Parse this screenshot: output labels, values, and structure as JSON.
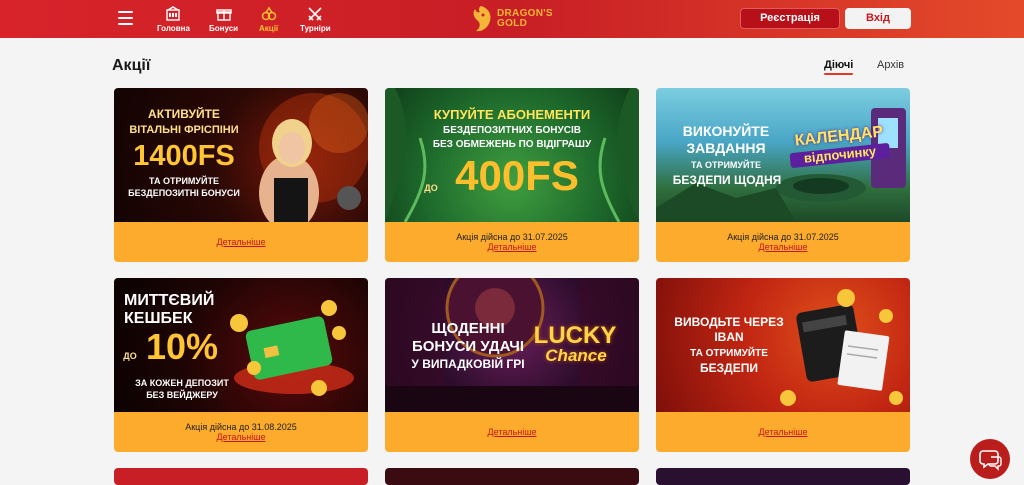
{
  "header": {
    "nav": [
      {
        "label": "Головна",
        "icon": "casino-icon"
      },
      {
        "label": "Бонуси",
        "icon": "gift-icon"
      },
      {
        "label": "Акції",
        "icon": "promo-icon"
      },
      {
        "label": "Турніри",
        "icon": "swords-icon"
      }
    ],
    "logo_line1": "DRAGON'S",
    "logo_line2": "GOLD",
    "register_label": "Реєстрація",
    "login_label": "Вхід",
    "colors": {
      "brand_red": "#d8232a",
      "accent_gold": "#fcab2c"
    }
  },
  "page": {
    "title": "Акції",
    "tabs": [
      {
        "label": "Діючі"
      },
      {
        "label": "Архів"
      }
    ]
  },
  "cards": [
    {
      "banner": [
        "АКТИВУЙТЕ",
        "ВІТАЛЬНІ ФРІСПІНИ",
        "1400FS",
        "ТА ОТРИМУЙТЕ",
        "БЕЗДЕПОЗИТНІ БОНУСИ"
      ],
      "valid": "",
      "more": "Детальніше"
    },
    {
      "banner": [
        "КУПУЙТЕ АБОНЕМЕНТИ",
        "БЕЗДЕПОЗИТНИХ БОНУСІВ",
        "БЕЗ ОБМЕЖЕНЬ ПО ВІДІГРАШУ",
        "ДО",
        "400FS"
      ],
      "valid": "Акція дійсна до 31.07.2025",
      "more": "Детальніше"
    },
    {
      "banner": [
        "ВИКОНУЙТЕ",
        "ЗАВДАННЯ",
        "ТА ОТРИМУЙТЕ",
        "БЕЗДЕПИ ЩОДНЯ",
        "КАЛЕНДАР",
        "відпочинку"
      ],
      "valid": "Акція дійсна до 31.07.2025",
      "more": "Детальніше"
    },
    {
      "banner": [
        "МИТТЄВИЙ",
        "КЕШБЕК",
        "ДО",
        "10%",
        "ЗА КОЖЕН ДЕПОЗИТ",
        "БЕЗ ВЕЙДЖЕРУ"
      ],
      "valid": "Акція дійсна до 31.08.2025",
      "more": "Детальніше"
    },
    {
      "banner": [
        "ЩОДЕННІ",
        "БОНУСИ УДАЧІ",
        "У ВИПАДКОВІЙ ГРІ",
        "LUCKY",
        "Chance"
      ],
      "valid": "",
      "more": "Детальніше"
    },
    {
      "banner": [
        "ВИВОДЬТЕ ЧЕРЕЗ",
        "IBAN",
        "ТА ОТРИМУЙТЕ",
        "БЕЗДЕПИ"
      ],
      "valid": "",
      "more": "Детальніше"
    }
  ]
}
